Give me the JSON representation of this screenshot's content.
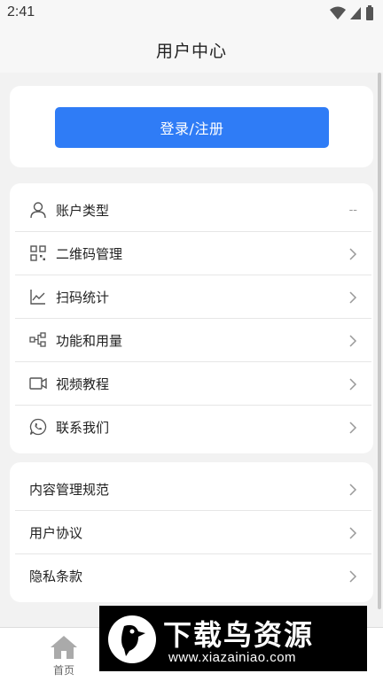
{
  "status": {
    "time": "2:41"
  },
  "header": {
    "title": "用户中心"
  },
  "login": {
    "label": "登录/注册"
  },
  "menu": {
    "items": [
      {
        "label": "账户类型",
        "value": "--",
        "icon": "user-icon"
      },
      {
        "label": "二维码管理",
        "icon": "qrcode-icon"
      },
      {
        "label": "扫码统计",
        "icon": "line-chart-icon"
      },
      {
        "label": "功能和用量",
        "icon": "flow-icon"
      },
      {
        "label": "视频教程",
        "icon": "video-icon"
      },
      {
        "label": "联系我们",
        "icon": "phone-chat-icon"
      }
    ]
  },
  "links": {
    "items": [
      {
        "label": "内容管理规范"
      },
      {
        "label": "用户协议"
      },
      {
        "label": "隐私条款"
      }
    ]
  },
  "tabbar": {
    "home_label": "首页"
  },
  "watermark": {
    "title": "下载鸟资源",
    "url": "www.xiazainiao.com"
  },
  "colors": {
    "accent": "#2f7cf6",
    "background": "#f2f2f2"
  }
}
